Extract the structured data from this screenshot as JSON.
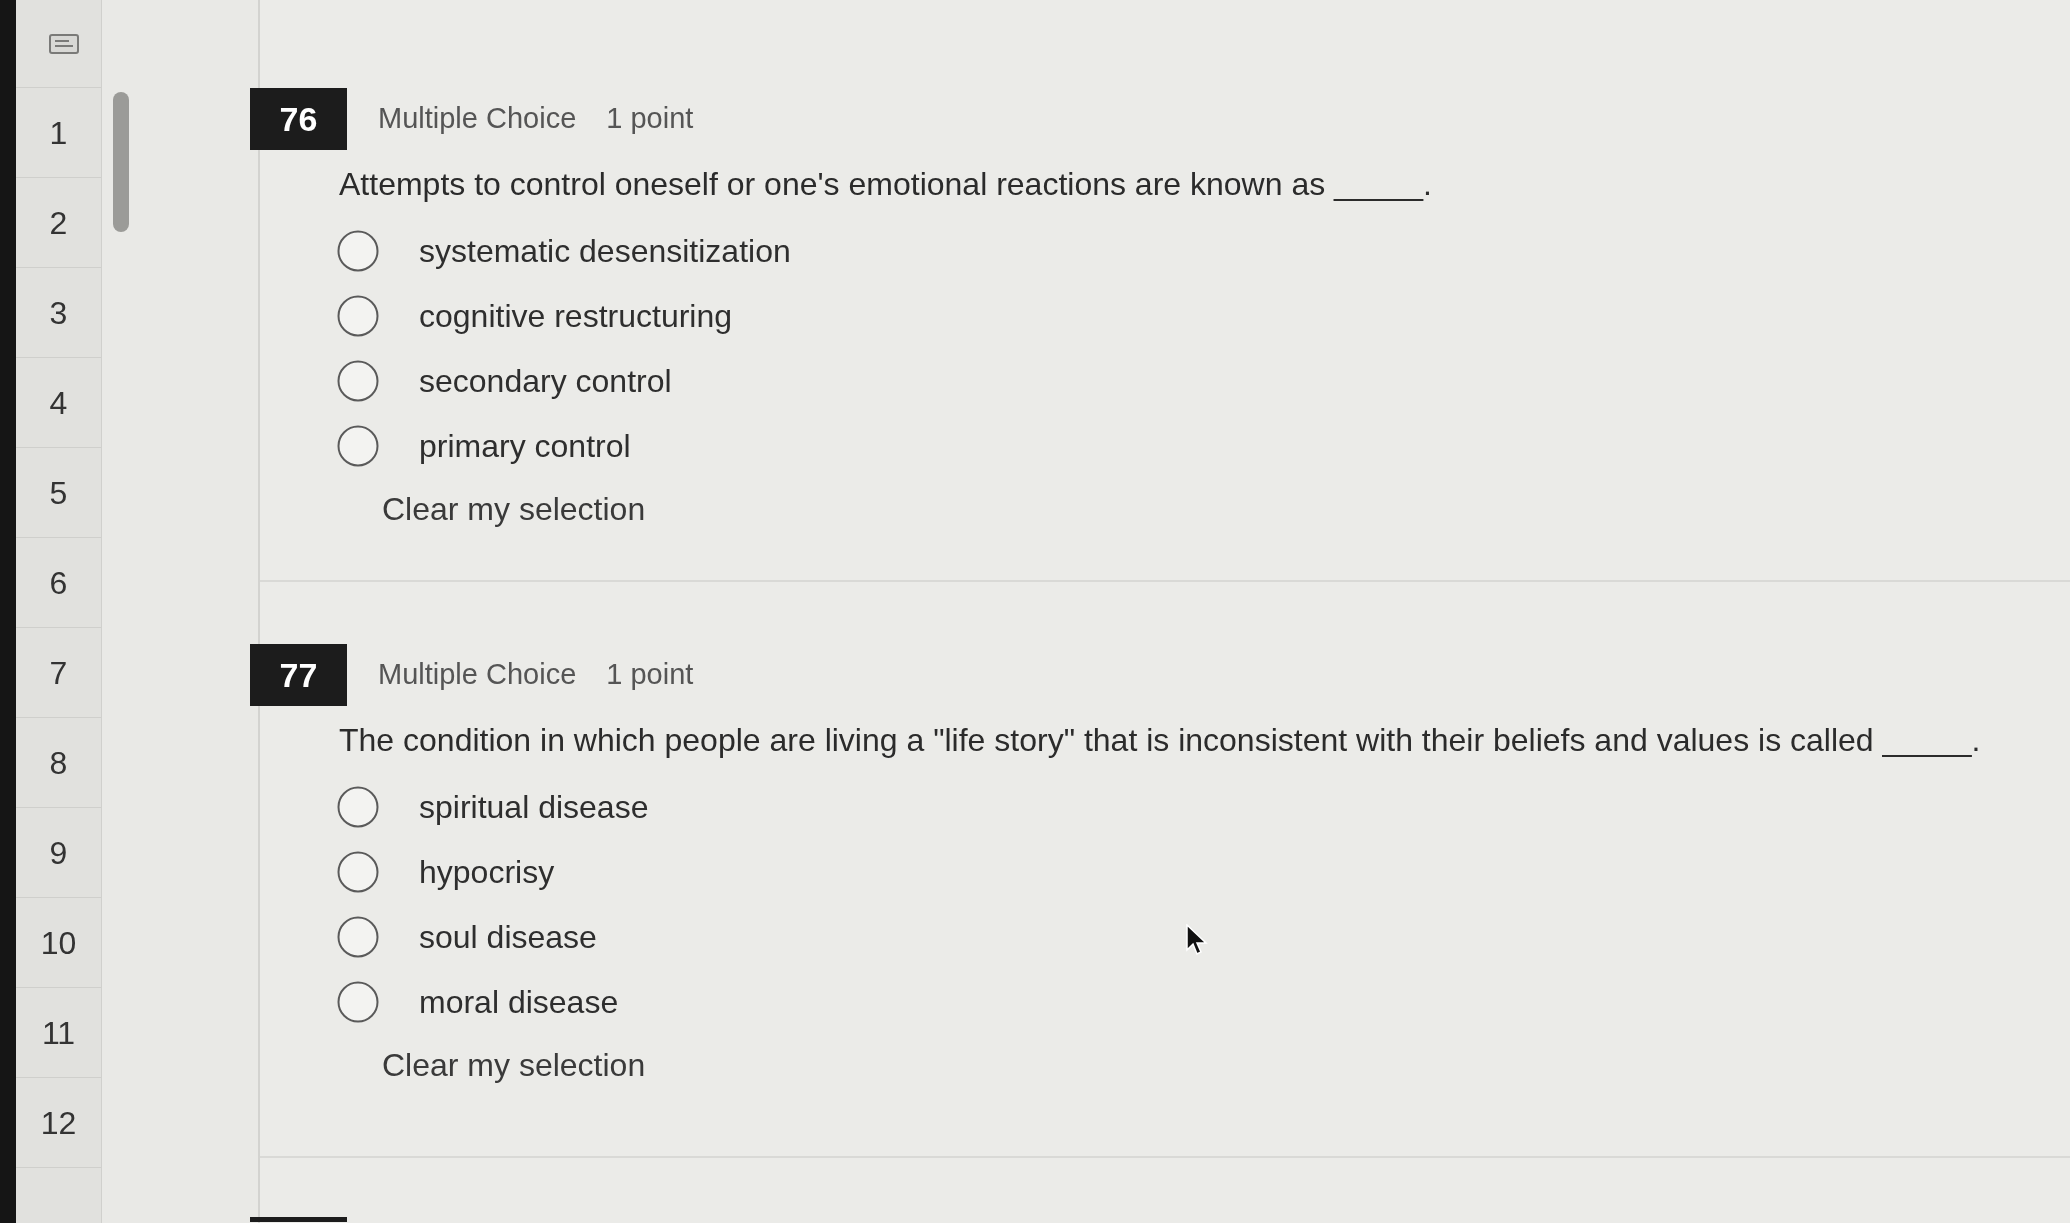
{
  "sidebar": {
    "items": [
      {
        "label": "1"
      },
      {
        "label": "2"
      },
      {
        "label": "3"
      },
      {
        "label": "4"
      },
      {
        "label": "5"
      },
      {
        "label": "6"
      },
      {
        "label": "7"
      },
      {
        "label": "8"
      },
      {
        "label": "9"
      },
      {
        "label": "10"
      },
      {
        "label": "11"
      },
      {
        "label": "12"
      }
    ]
  },
  "questions": [
    {
      "number": "76",
      "type": "Multiple Choice",
      "points": "1 point",
      "prompt": "Attempts to control oneself or one's emotional reactions are known as _____.",
      "options": [
        {
          "label": "systematic desensitization",
          "selected": false
        },
        {
          "label": "cognitive restructuring",
          "selected": false
        },
        {
          "label": "secondary control",
          "selected": false
        },
        {
          "label": "primary control",
          "selected": false
        }
      ],
      "clear_link": "Clear my selection"
    },
    {
      "number": "77",
      "type": "Multiple Choice",
      "points": "1 point",
      "prompt": "The condition in which people are living a \"life story\" that is inconsistent with their beliefs and values is called _____.",
      "options": [
        {
          "label": "spiritual disease",
          "selected": false
        },
        {
          "label": "hypocrisy",
          "selected": false
        },
        {
          "label": "soul disease",
          "selected": false
        },
        {
          "label": "moral disease",
          "selected": false
        }
      ],
      "clear_link": "Clear my selection"
    }
  ]
}
